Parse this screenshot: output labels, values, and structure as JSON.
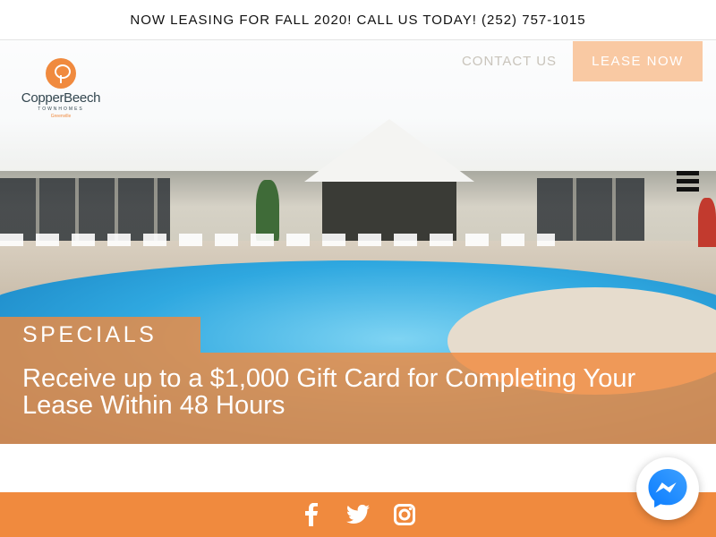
{
  "announcement": {
    "text": "NOW LEASING FOR FALL 2020! CALL US TODAY! (252) 757-1015"
  },
  "brand": {
    "name": "CopperBeech",
    "subtitle": "TOWNHOMES",
    "city": "Greenville",
    "accent_color": "#f08a3e"
  },
  "nav": {
    "contact_label": "CONTACT US",
    "lease_label": "LEASE NOW",
    "menu_icon": "hamburger-icon"
  },
  "specials": {
    "label": "SPECIALS",
    "headline": "Receive up to a $1,000 Gift Card for Completing Your Lease Within 48 Hours"
  },
  "footer": {
    "social_icons": [
      "facebook-icon",
      "twitter-icon",
      "instagram-icon"
    ]
  },
  "chat": {
    "icon": "messenger-icon"
  }
}
